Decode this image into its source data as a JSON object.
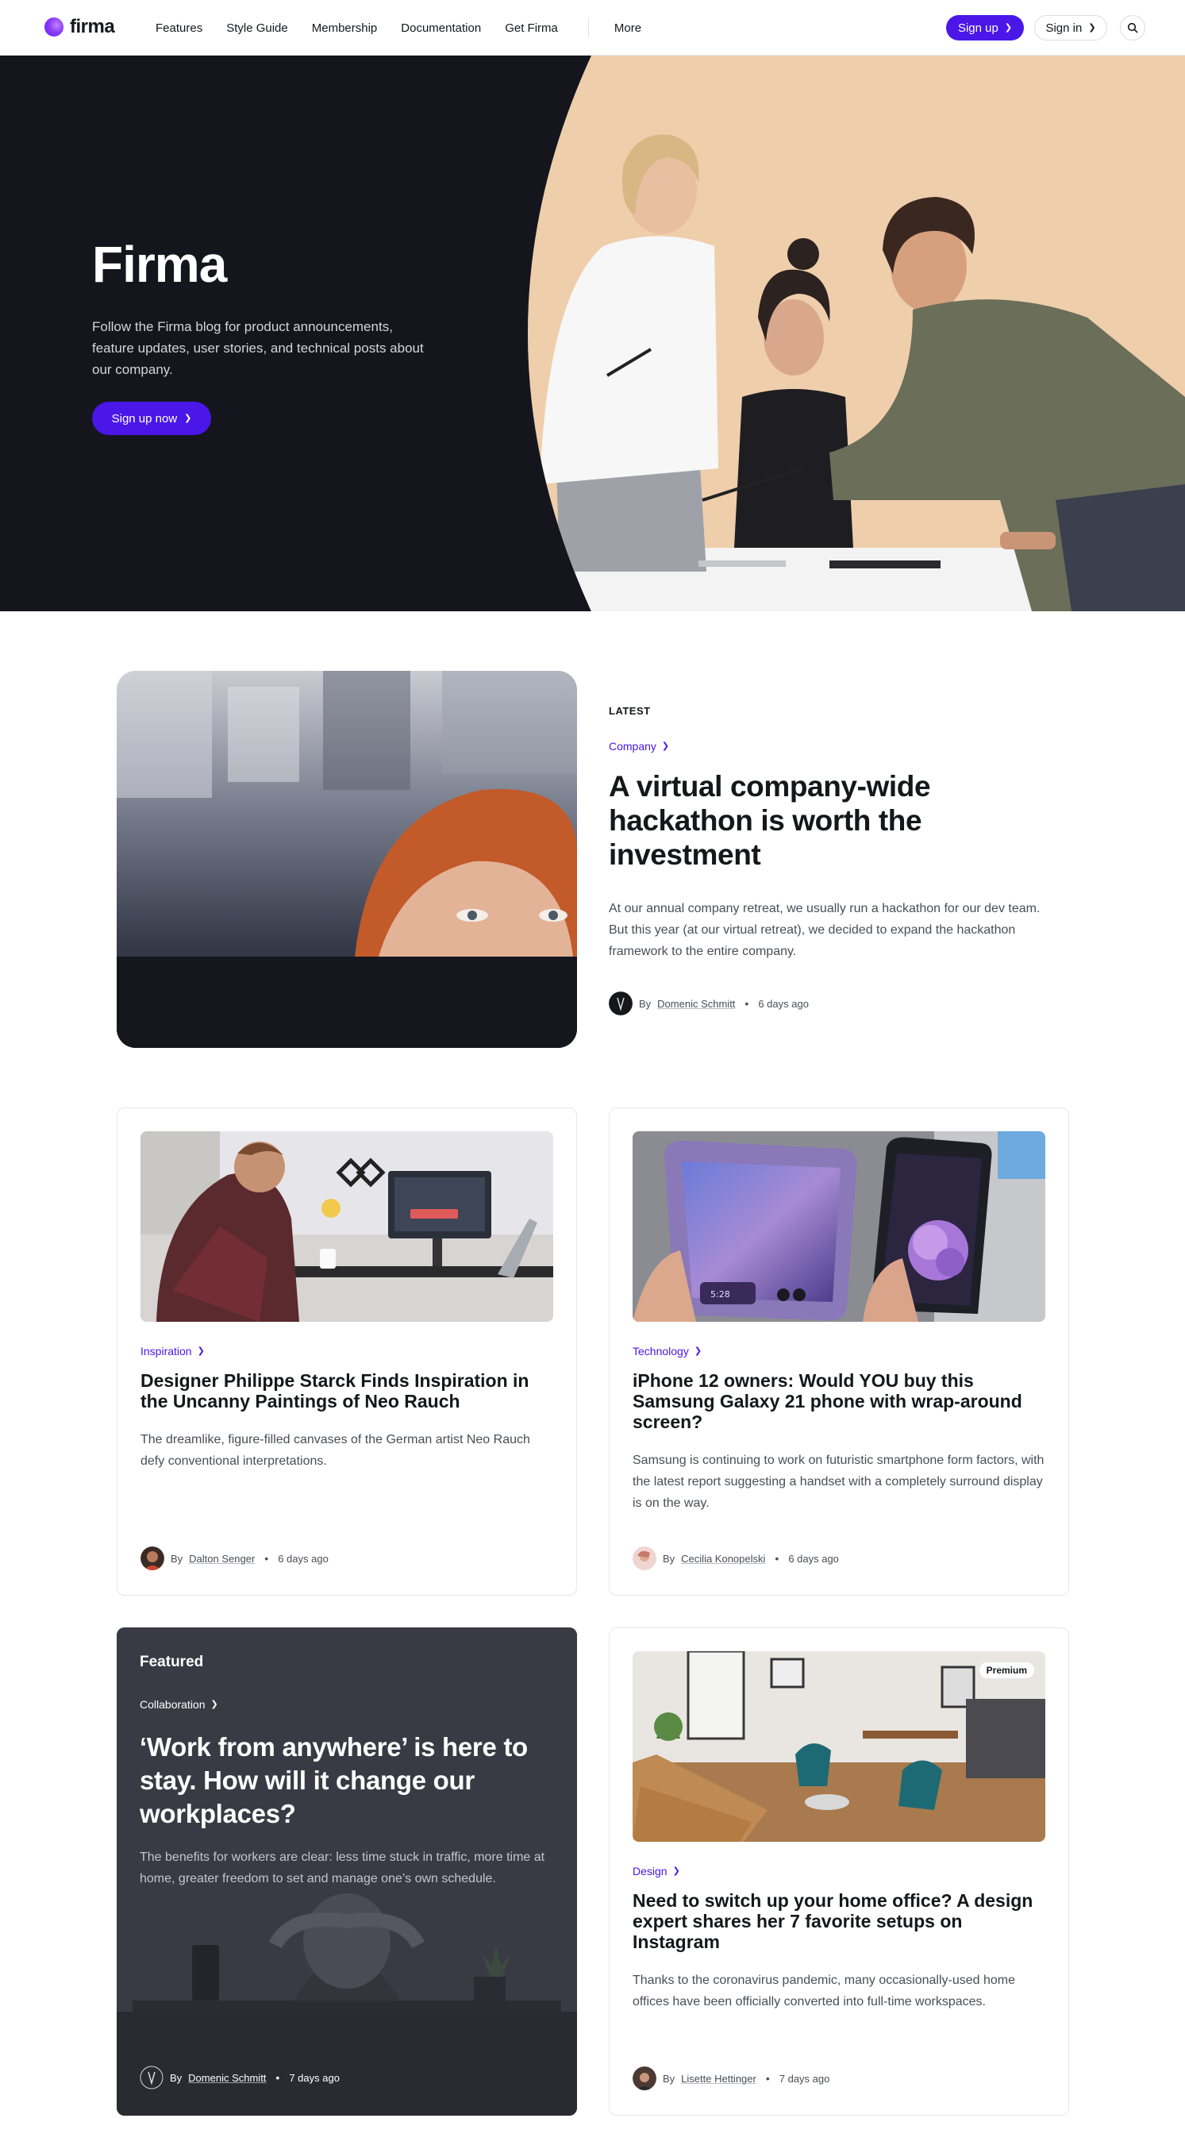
{
  "header": {
    "logo": "firma",
    "nav": [
      "Features",
      "Style Guide",
      "Membership",
      "Documentation",
      "Get Firma"
    ],
    "more": "More",
    "signup": "Sign up",
    "signin": "Sign in",
    "search_icon": "search-icon",
    "accent": "#4a17e8"
  },
  "hero": {
    "title": "Firma",
    "description": "Follow the Firma blog for product announcements, feature updates, user stories, and technical posts about our company.",
    "button": "Sign up now",
    "background": "#15151e"
  },
  "latest": {
    "label": "LATEST",
    "tag": "Company",
    "title": "A virtual company-wide hackathon is worth the investment",
    "excerpt": "At our annual company retreat, we usually run a hackathon for our dev team. But this year (at our virtual retreat), we decided to expand the hackathon framework to the entire company.",
    "by": "By",
    "author": "Domenic Schmitt",
    "date": "6 days ago"
  },
  "cards": [
    {
      "tag": "Inspiration",
      "title": "Designer Philippe Starck Finds Inspiration in the Uncanny Paintings of Neo Rauch",
      "excerpt": "The dreamlike, figure-filled canvases of the German artist Neo Rauch defy conventional interpretations.",
      "by": "By",
      "author": "Dalton Senger",
      "date": "6 days ago"
    },
    {
      "tag": "Technology",
      "title": "iPhone 12 owners: Would YOU buy this Samsung Galaxy 21 phone with wrap-around screen?",
      "excerpt": "Samsung is continuing to work on futuristic smartphone form factors, with the latest report suggesting a handset with a completely surround display is on the way.",
      "by": "By",
      "author": "Cecilia Konopelski",
      "date": "6 days ago",
      "phone_time": "5:28"
    },
    {
      "featured_label": "Featured",
      "tag": "Collaboration",
      "title": "‘Work from anywhere’ is here to stay. How will it change our workplaces?",
      "excerpt": "The benefits for workers are clear: less time stuck in traffic, more time at home, greater freedom to set and manage one’s own schedule.",
      "by": "By",
      "author": "Domenic Schmitt",
      "date": "7 days ago"
    },
    {
      "badge": "Premium",
      "tag": "Design",
      "title": "Need to switch up your home office? A design expert shares her 7 favorite setups on Instagram",
      "excerpt": "Thanks to the coronavirus pandemic, many occasionally-used home offices have been officially converted into full-time workspaces.",
      "by": "By",
      "author": "Lisette Hettinger",
      "date": "7 days ago"
    }
  ]
}
